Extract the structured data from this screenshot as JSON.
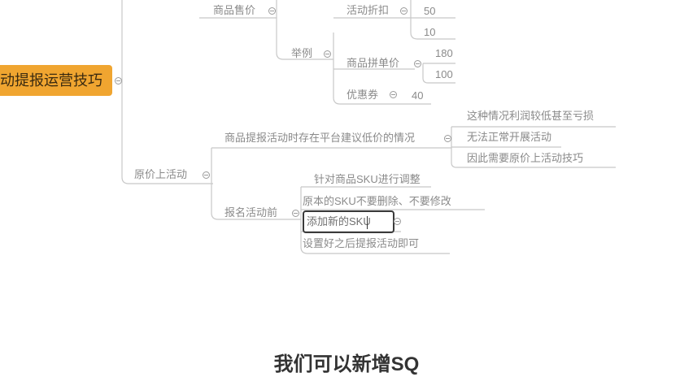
{
  "root": {
    "label": "动提报运营技巧"
  },
  "branches": {
    "price_label": "商品售价",
    "discount_label": "活动折扣",
    "discount_values": [
      "50",
      "10"
    ],
    "example_label": "举例",
    "group_price_label": "商品拼单价",
    "group_price_values": [
      "180",
      "100"
    ],
    "coupon_label": "优惠券",
    "coupon_value": "40",
    "original_price_label": "原价上活动",
    "low_price_label": "商品提报活动时存在平台建议低价的情况",
    "low_price_items": [
      "这种情况利润较低甚至亏损",
      "无法正常开展活动",
      "因此需要原价上活动技巧"
    ],
    "before_signup_label": "报名活动前",
    "before_signup_items": [
      "针对商品SKU进行调整",
      "原本的SKU不要删除、不要修改",
      "添加新的SKU",
      "设置好之后提报活动即可"
    ]
  },
  "subtitle": "我们可以新增SQ"
}
